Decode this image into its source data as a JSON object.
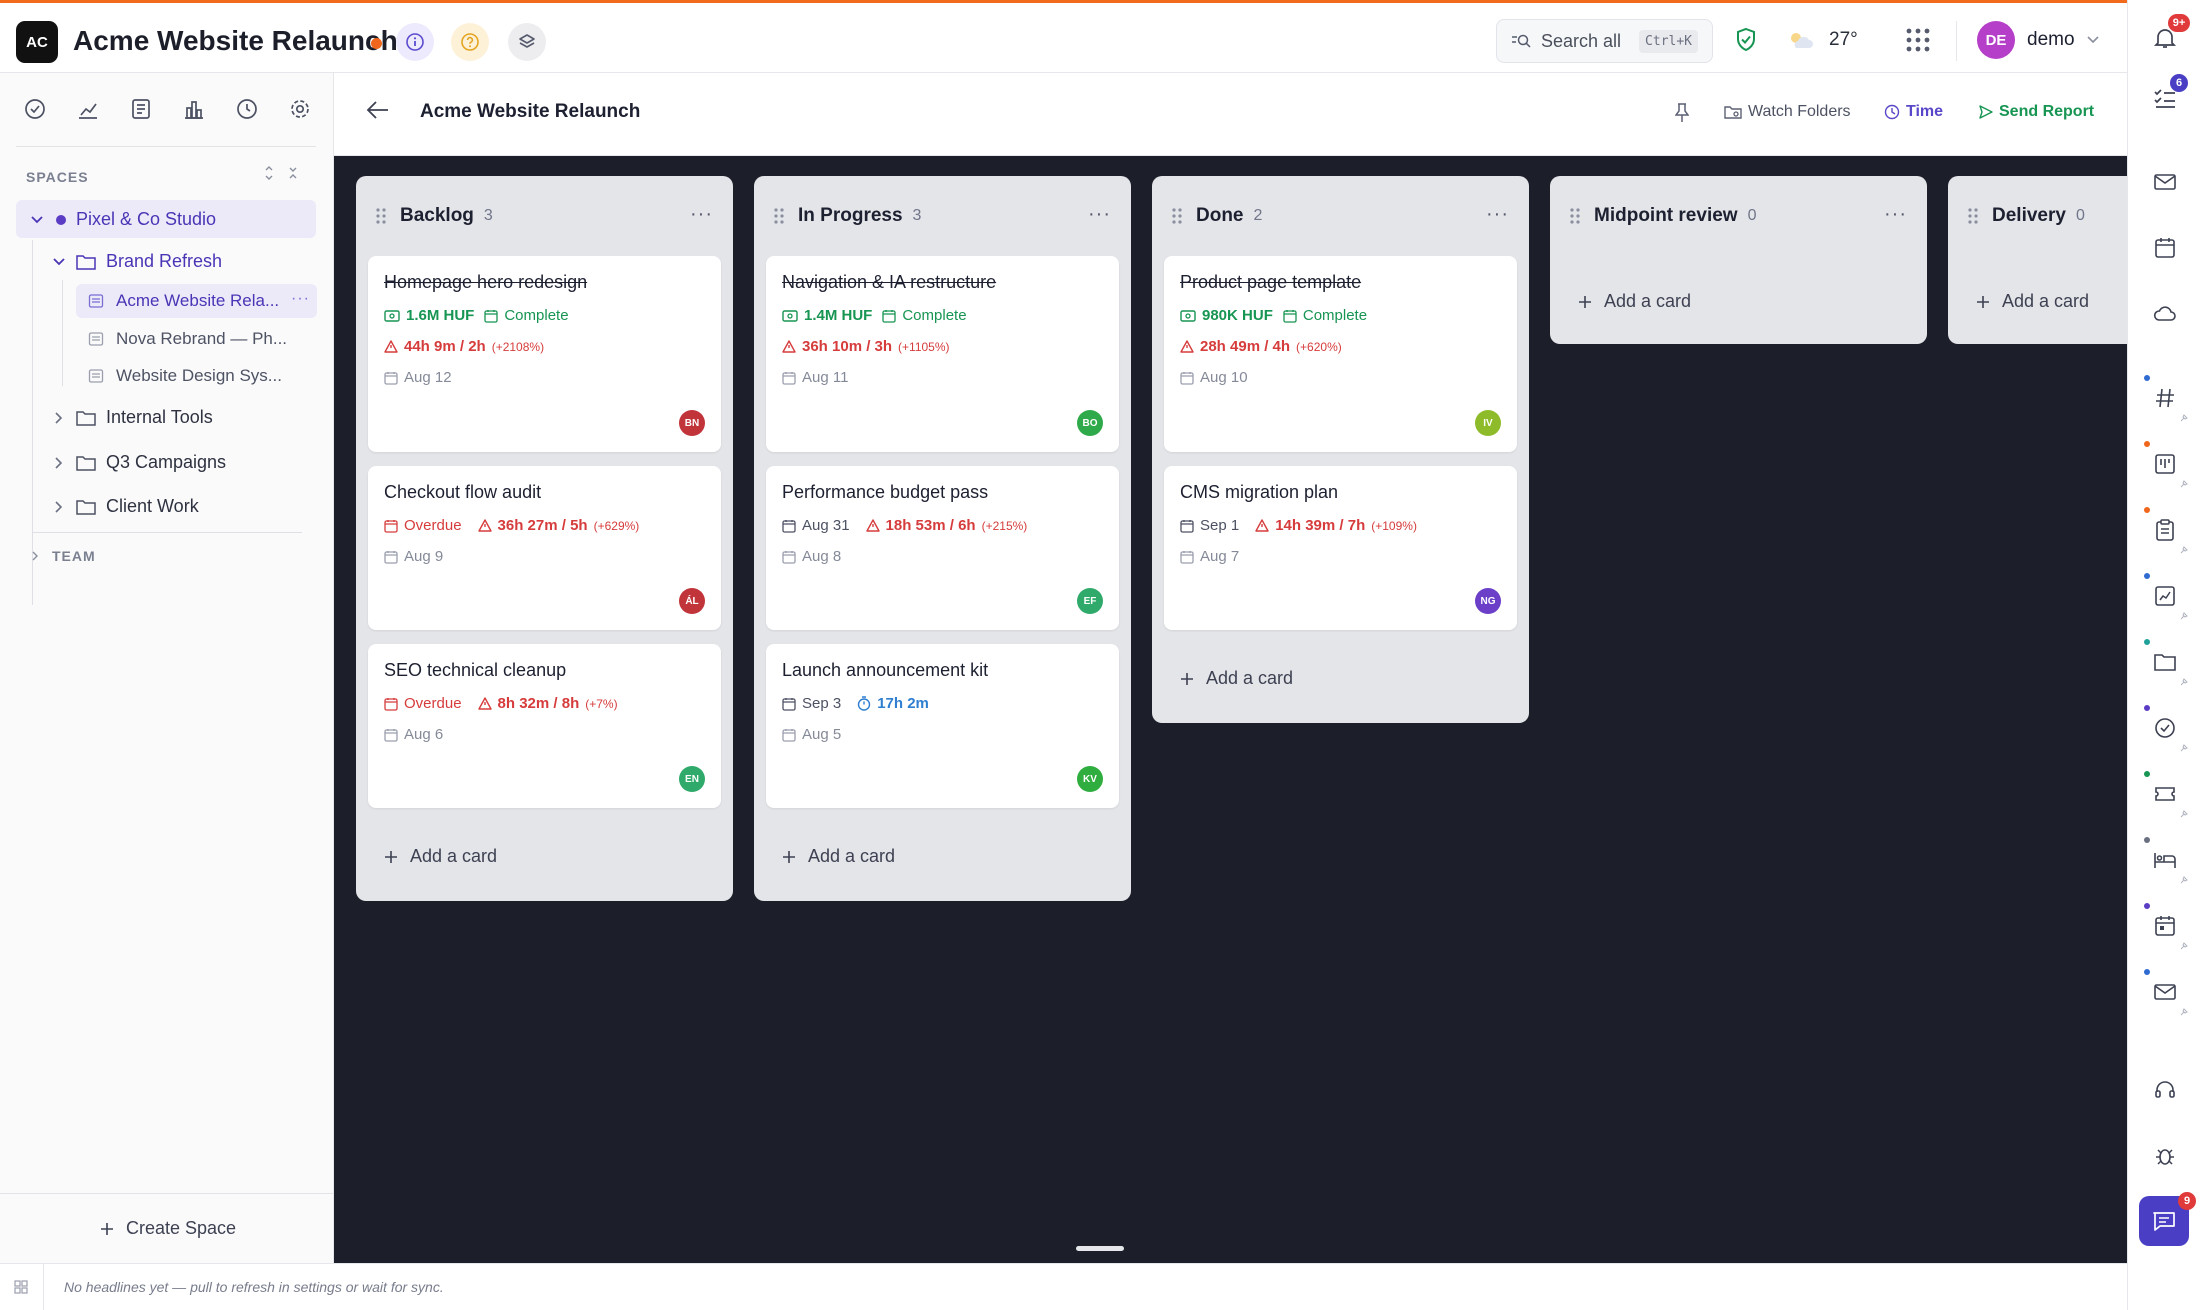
{
  "header": {
    "logo_text": "AC",
    "title": "Acme Website Relaunch",
    "search_label": "Search all",
    "search_shortcut": "Ctrl+K",
    "weather_temp": "27°",
    "user_initials": "DE",
    "user_name": "demo",
    "notification_badge": "9+"
  },
  "sidebar": {
    "spaces_label": "SPACES",
    "space_name": "Pixel & Co Studio",
    "folders": [
      {
        "label": "Brand Refresh",
        "expanded": true
      },
      {
        "label": "Internal Tools"
      },
      {
        "label": "Q3 Campaigns"
      },
      {
        "label": "Client Work"
      }
    ],
    "boards": [
      "Acme Website Rela...",
      "Nova Rebrand — Ph...",
      "Website Design Sys..."
    ],
    "team_label": "TEAM",
    "create_space": "Create Space"
  },
  "subheader": {
    "title": "Acme Website Relaunch",
    "watch_folders": "Watch Folders",
    "time": "Time",
    "send_report": "Send Report"
  },
  "columns": [
    {
      "title": "Backlog",
      "count": "3",
      "cards": [
        {
          "title": "Homepage hero redesign",
          "budget": "1.6M HUF",
          "status": "Complete",
          "time": "44h 9m / 2h",
          "pct": "(+2108%)",
          "date": "Aug 12",
          "avatar": "BN"
        },
        {
          "title": "Checkout flow audit",
          "due": "Overdue",
          "time": "36h 27m / 5h",
          "pct": "(+629%)",
          "date": "Aug 9",
          "avatar": "ÁL"
        },
        {
          "title": "SEO technical cleanup",
          "due": "Overdue",
          "time": "8h 32m / 8h",
          "pct": "(+7%)",
          "date": "Aug 6",
          "avatar": "EN"
        }
      ],
      "add": "Add a card"
    },
    {
      "title": "In Progress",
      "count": "3",
      "cards": [
        {
          "title": "Navigation & IA restructure",
          "budget": "1.4M HUF",
          "status": "Complete",
          "time": "36h 10m / 3h",
          "pct": "(+1105%)",
          "date": "Aug 11",
          "avatar": "BO"
        },
        {
          "title": "Performance budget pass",
          "due": "Aug 31",
          "time": "18h 53m / 6h",
          "pct": "(+215%)",
          "date": "Aug 8",
          "avatar": "EF"
        },
        {
          "title": "Launch announcement kit",
          "due": "Sep 3",
          "timer": "17h 2m",
          "date": "Aug 5",
          "avatar": "KV"
        }
      ],
      "add": "Add a card"
    },
    {
      "title": "Done",
      "count": "2",
      "cards": [
        {
          "title": "Product page template",
          "budget": "980K HUF",
          "status": "Complete",
          "time": "28h 49m / 4h",
          "pct": "(+620%)",
          "date": "Aug 10",
          "avatar": "IV"
        },
        {
          "title": "CMS migration plan",
          "due": "Sep 1",
          "time": "14h 39m / 7h",
          "pct": "(+109%)",
          "date": "Aug 7",
          "avatar": "NG"
        }
      ],
      "add": "Add a card"
    },
    {
      "title": "Midpoint review",
      "count": "0",
      "add": "Add a card"
    },
    {
      "title": "Delivery",
      "count": "0",
      "add": "Add a card"
    }
  ],
  "rail": {
    "tasks_badge": "6",
    "chat_badge": "9"
  },
  "footer": {
    "headline": "No headlines yet — pull to refresh in settings or wait for sync."
  },
  "colors": {
    "accent_orange": "#f26b1d",
    "space_purple": "#5b3cc4",
    "success_green": "#179552",
    "danger_red": "#d63c3c",
    "board_bg": "#1c1e29"
  }
}
